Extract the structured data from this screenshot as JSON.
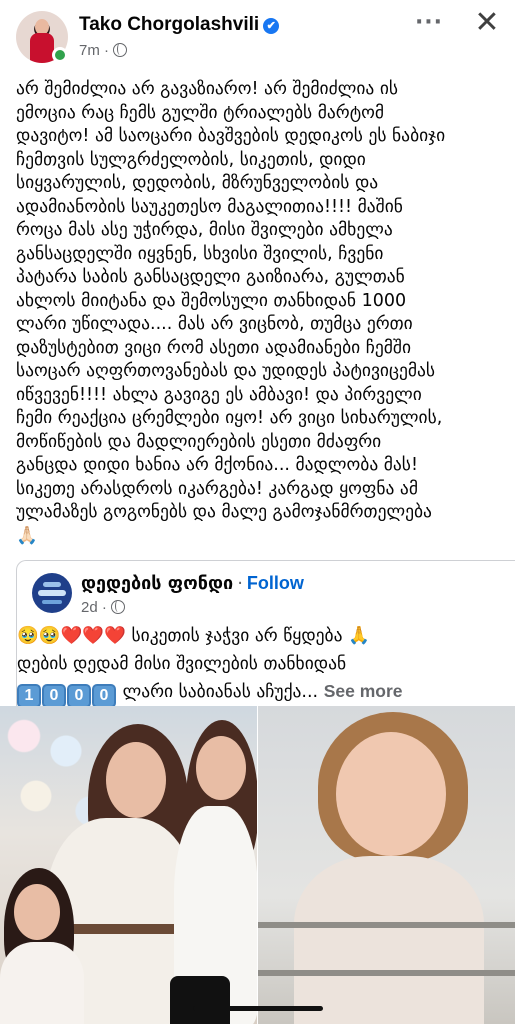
{
  "header": {
    "author_name": "Tako Chorgolashvili",
    "verified_icon": "✔",
    "time_ago": "7m",
    "separator": "·",
    "more_label": "···",
    "close_label": "✕"
  },
  "post": {
    "text": "არ შემიძლია არ გავაზიარო! არ შემიძლია ის\nემოცია რაც ჩემს გულში ტრიალებს მარტომ\nდავიტო! ამ საოცარი ბავშვების დედიკოს ეს ნაბიჯი\nჩემთვის სულგრძელობის, სიკეთის, დიდი\nსიყვარულის, დედობის, მზრუნველობის და\nადამიანობის საუკეთესო მაგალითია!!!! მაშინ\nროცა მას ასე უჭირდა, მისი შვილები ამხელა\nგანსაცდელში იყვნენ, სხვისი შვილის, ჩვენი\nპატარა საბის განსაცდელი გაიზიარა, გულთან\nახლოს მიიტანა  და შემოსული თანხიდან  1000\nლარი უწილადა.... მას არ ვიცნობ, თუმცა ერთი\nდაზუსტებით ვიცი რომ ასეთი ადამიანები ჩემში\nსაოცარ  აღფრთოვანებას და უდიდეს პატივიცემას\nიწვევენ!!!! ახლა გავიგე ეს ამბავი! და პირველი\nჩემი რეაქცია ცრემლები იყო! არ ვიცი სიხარულის,\nმოწიწების და მადლიერების ესეთი მძაფრი\nგანცდა დიდი ხანია არ მქონია... მადლობა მას!\nსიკეთე არასდროს იკარგება! კარგად ყოფნა  ამ\nულამაზეს გოგონებს და მალე გამოჯანმრთელება\n🙏🏻"
  },
  "shared_post": {
    "page_name": "დედების ფონდი",
    "follow_label": "Follow",
    "time_ago": "2d",
    "line1": "🥹🥹❤️❤️❤️ სიკეთის ჯაჭვი არ წყდება 🙏",
    "line2": "დების დედამ მისი შვილების თანხიდან",
    "digits": [
      "1",
      "0",
      "0",
      "0"
    ],
    "line3": " ლარი საბიანას აჩუქა...",
    "see_more_label": "See more"
  }
}
